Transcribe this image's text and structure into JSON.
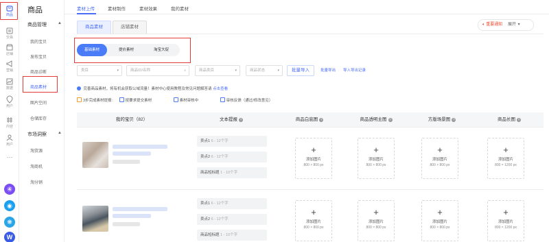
{
  "rail": {
    "items": [
      {
        "label": "商品"
      },
      {
        "label": "交易"
      },
      {
        "label": "店铺"
      },
      {
        "label": "营销"
      },
      {
        "label": "数据"
      },
      {
        "label": "用户"
      },
      {
        "label": "内容"
      },
      {
        "label": "用户"
      }
    ],
    "more": "···"
  },
  "subnav": {
    "title": "商品",
    "group1": "商品管理",
    "items1": [
      "我的宝贝",
      "发布宝贝",
      "商品诊断",
      "商品素材",
      "图片空间",
      "仓储库存"
    ],
    "group2": "市场洞察",
    "items2": [
      "淘货源",
      "淘商机",
      "淘分销"
    ]
  },
  "toptabs": [
    "素材上传",
    "素材制作",
    "素材效果",
    "我的素材"
  ],
  "source_tabs": [
    "商品素材",
    "店铺素材"
  ],
  "notice": {
    "label": "重要通知",
    "expand": "展开"
  },
  "segments": [
    "基础素材",
    "提价素材",
    "淘宝大促"
  ],
  "filters": {
    "f1": "类目",
    "f2": "商品ID/名称",
    "f3": "商品类目",
    "f4": "商品状态",
    "batch_import": "批量导入",
    "batch_export": "批量导出",
    "import_record": "导入导出记录"
  },
  "tip": {
    "text": "完善商品素材，将有机会获取公域流量！素材中心使用教程及常见问题解答请",
    "link": "点击查看"
  },
  "steps": [
    "3步完成素材提报:",
    "按要求提交素材",
    "素材审核中",
    "审核反馈（通过/修改意见）"
  ],
  "table": {
    "headers": [
      "我的宝贝（82）",
      "文本提报",
      "商品白底图",
      "商品透明主图",
      "方版场景图",
      "商品长图"
    ],
    "text_fields": [
      {
        "label": "卖点1",
        "hint": "6 - 12个字"
      },
      {
        "label": "卖点2",
        "hint": "6 - 12个字"
      },
      {
        "label": "商品短标题",
        "hint": "1 - 10个字"
      }
    ],
    "upload_label": "添加图片",
    "upload_sizes": [
      "800 × 800 px",
      "800 × 800 px",
      "800 × 800 px",
      "800 × 1200 px"
    ]
  },
  "colors": {
    "accent": "#4a6cf7",
    "highlight": "#e53935",
    "notice": "#f04b2f"
  }
}
